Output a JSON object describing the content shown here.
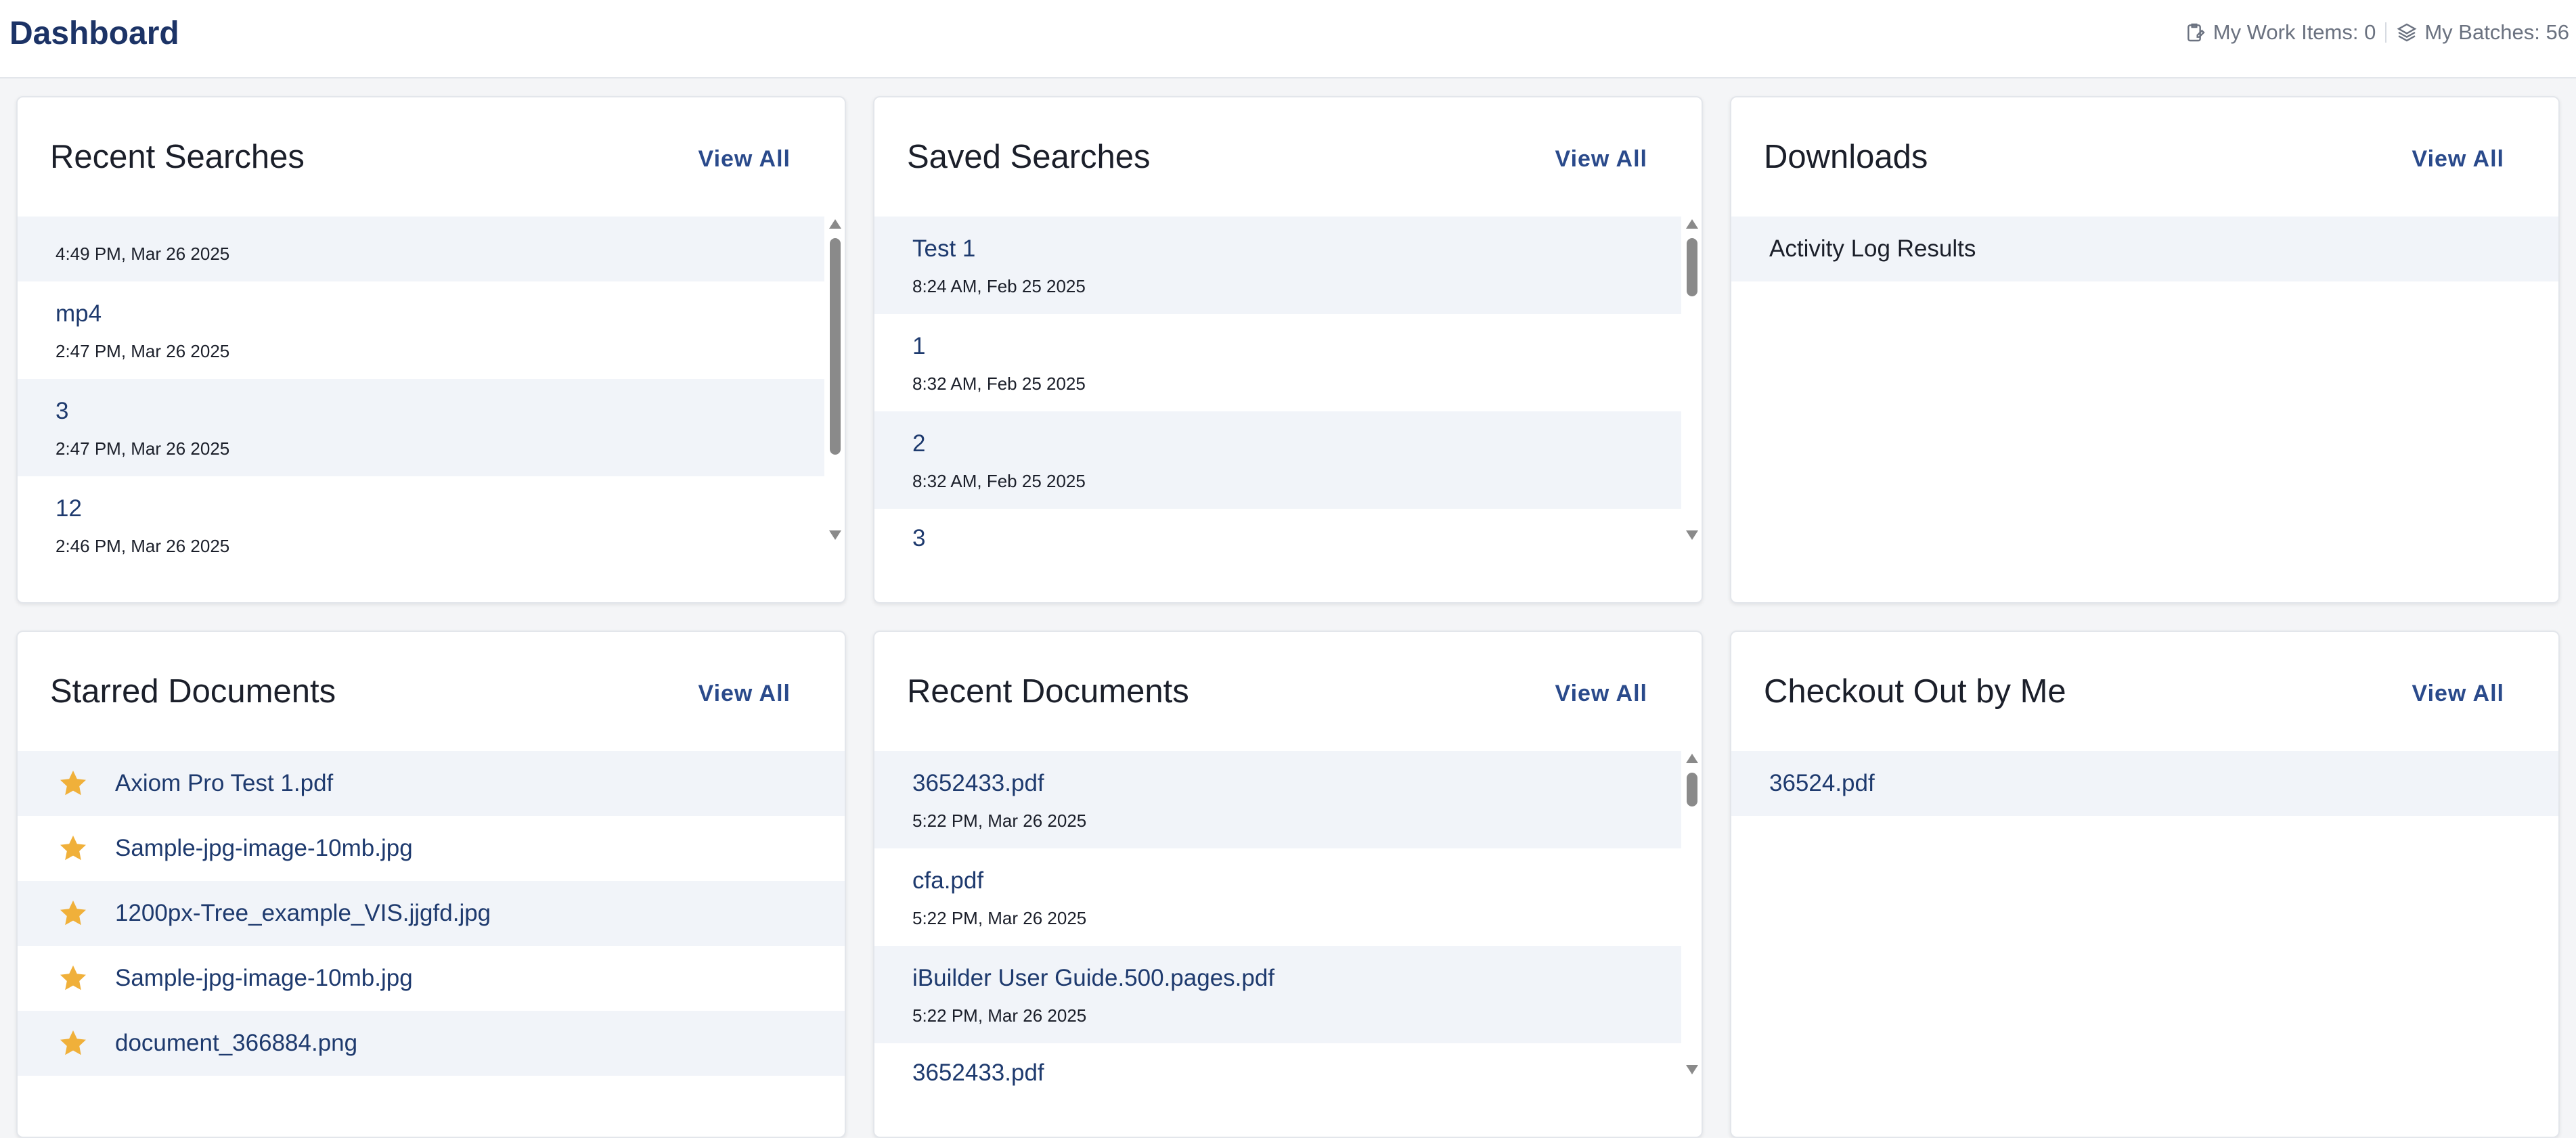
{
  "header": {
    "title": "Dashboard",
    "work_items": "My Work Items: 0",
    "batches": "My Batches: 56",
    "work_items_icon": "clipboard-edit-icon",
    "batches_icon": "layers-icon"
  },
  "colors": {
    "accent": "#2a4a8b",
    "title": "#1c3366",
    "stripe": "#f1f4f9",
    "star": "#f0b03a"
  },
  "recent_searches": {
    "title": "Recent Searches",
    "view_all": "View All",
    "items": [
      {
        "name": "",
        "date": "4:49 PM, Mar 26 2025"
      },
      {
        "name": "mp4",
        "date": "2:47 PM, Mar 26 2025"
      },
      {
        "name": "3",
        "date": "2:47 PM, Mar 26 2025"
      },
      {
        "name": "12",
        "date": "2:46 PM, Mar 26 2025"
      }
    ]
  },
  "saved_searches": {
    "title": "Saved Searches",
    "view_all": "View All",
    "items": [
      {
        "name": "Test 1",
        "date": "8:24 AM, Feb 25 2025"
      },
      {
        "name": "1",
        "date": "8:32 AM, Feb 25 2025"
      },
      {
        "name": "2",
        "date": "8:32 AM, Feb 25 2025"
      },
      {
        "name": "3",
        "date": ""
      }
    ]
  },
  "downloads": {
    "title": "Downloads",
    "view_all": "View All",
    "items": [
      {
        "name": "Activity Log Results"
      }
    ]
  },
  "starred_documents": {
    "title": "Starred Documents",
    "view_all": "View All",
    "items": [
      {
        "name": "Axiom Pro Test 1.pdf"
      },
      {
        "name": "Sample-jpg-image-10mb.jpg"
      },
      {
        "name": "1200px-Tree_example_VIS.jjgfd.jpg"
      },
      {
        "name": "Sample-jpg-image-10mb.jpg"
      },
      {
        "name": "document_366884.png"
      }
    ]
  },
  "recent_documents": {
    "title": "Recent Documents",
    "view_all": "View All",
    "items": [
      {
        "name": "3652433.pdf",
        "date": "5:22 PM, Mar 26 2025"
      },
      {
        "name": "cfa.pdf",
        "date": "5:22 PM, Mar 26 2025"
      },
      {
        "name": "iBuilder User Guide.500.pages.pdf",
        "date": "5:22 PM, Mar 26 2025"
      },
      {
        "name": "3652433.pdf",
        "date": ""
      }
    ]
  },
  "checked_out": {
    "title": "Checkout Out by Me",
    "view_all": "View All",
    "items": [
      {
        "name": "36524.pdf"
      }
    ]
  }
}
